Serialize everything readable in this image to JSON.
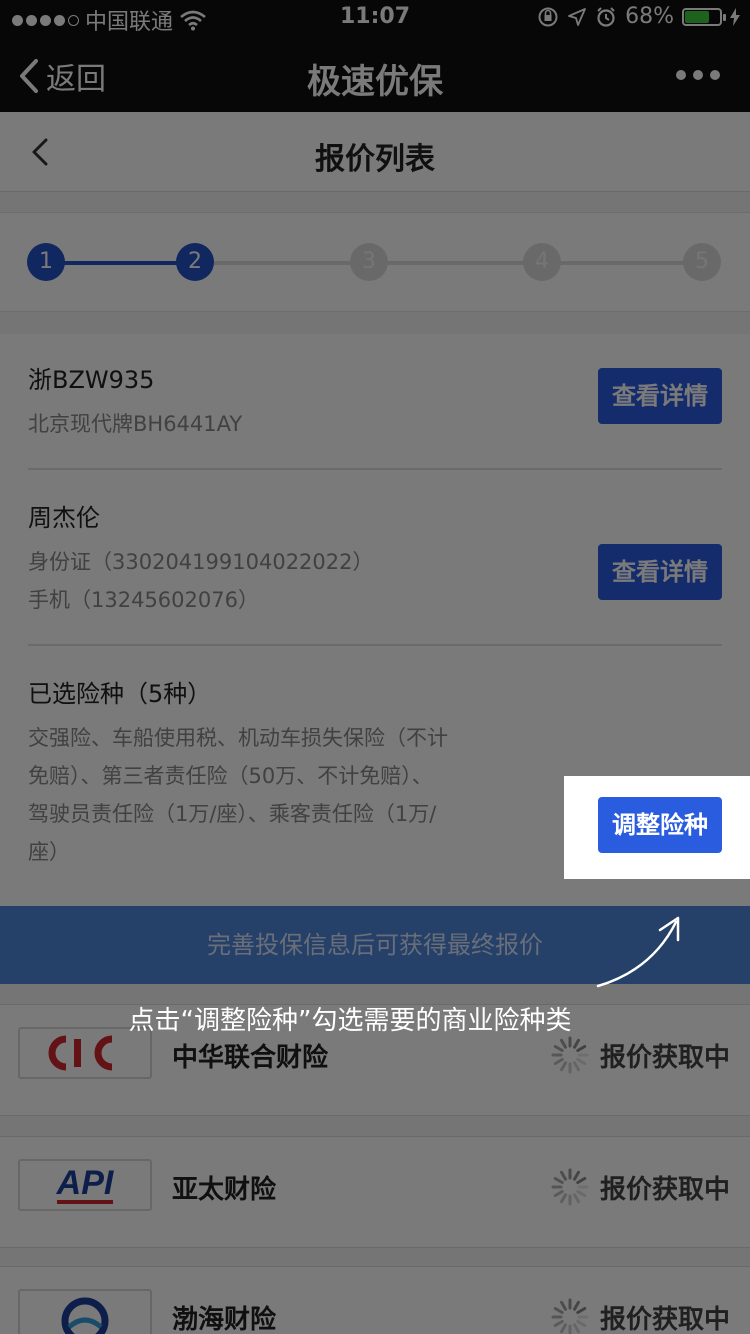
{
  "status_bar": {
    "carrier": "中国联通",
    "time": "11:07",
    "battery": "68%"
  },
  "nav": {
    "back_label": "返回",
    "title": "极速优保"
  },
  "page": {
    "title": "报价列表"
  },
  "steps": [
    "1",
    "2",
    "3",
    "4",
    "5"
  ],
  "steps_current": 2,
  "vehicle": {
    "plate": "浙BZW935",
    "model": "北京现代牌BH6441AY",
    "button": "查看详情"
  },
  "owner": {
    "name": "周杰伦",
    "id_line": "身份证（330204199104022022）",
    "phone_line": "手机（13245602076）",
    "button": "查看详情"
  },
  "coverage": {
    "title": "已选险种（5种）",
    "lines": [
      "交强险、车船使用税、机动车损失保险（不计",
      "免赔）、第三者责任险（50万、不计免赔）、",
      "驾驶员责任险（1万/座）、乘客责任险（1万/",
      "座）"
    ],
    "button": "调整险种"
  },
  "banner": {
    "text": "完善投保信息后可获得最终报价"
  },
  "insurers": [
    {
      "name": "中华联合财险",
      "status": "报价获取中",
      "logo_icon": "cic-logo-icon",
      "logo_text": "cic"
    },
    {
      "name": "亚太财险",
      "status": "报价获取中",
      "logo_icon": "api-logo-icon",
      "logo_text": "API"
    },
    {
      "name": "渤海财险",
      "status": "报价获取中",
      "logo_icon": "bohai-logo-icon",
      "logo_text": ""
    }
  ],
  "guide": {
    "hint": "点击“调整险种”勾选需要的商业险种类"
  },
  "colors": {
    "primary_button": "#2a5ce0",
    "banner": "#4f86dc",
    "step_active": "#2552c8",
    "logo_red": "#d0262d"
  }
}
